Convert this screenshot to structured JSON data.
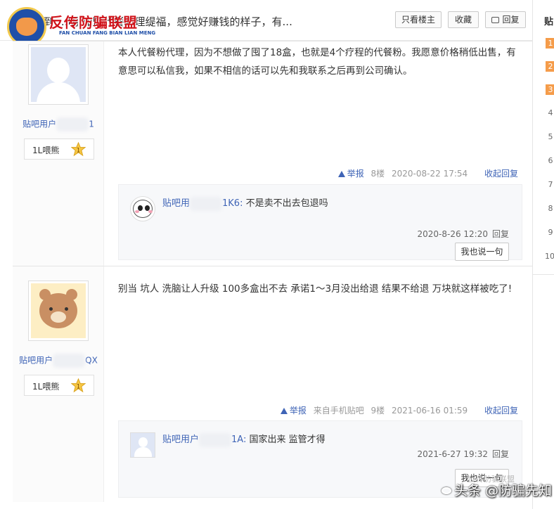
{
  "header": {
    "title": "到 …明 加盟代餐粉理缇福，感觉好赚钱的样子，有...",
    "only_author": "只看楼主",
    "favorite": "收藏",
    "reply": "回复"
  },
  "logo": {
    "text": "反传防骗联盟",
    "sub": "FAN CHUAN FANG BIAN LIAN MENG"
  },
  "sidebar": {
    "heading": "贴",
    "ranks": [
      "1",
      "2",
      "3",
      "4",
      "5",
      "6",
      "7",
      "8",
      "9",
      "10"
    ]
  },
  "posts": [
    {
      "author_prefix": "贴吧用户",
      "author_suffix": "1",
      "level": "1L喂熊",
      "level_badge": "1",
      "content": "本人代餐粉代理，因为不想做了囤了18盒，也就是4个疗程的代餐粉。我愿意价格稍低出售，有意思可以私信我，如果不相信的话可以先和我联系之后再到公司确认。",
      "report": "举报",
      "source": "",
      "floor": "8楼",
      "time": "2020-08-22 17:54",
      "collapse": "收起回复",
      "reply": {
        "user_prefix": "贴吧用",
        "user_suffix": "1K6:",
        "text": "不是卖不出去包退吗",
        "time": "2020-8-26 12:20",
        "reply_label": "回复",
        "say_button": "我也说一句"
      }
    },
    {
      "author_prefix": "贴吧用户",
      "author_suffix": "QX",
      "level": "1L喂熊",
      "level_badge": "1",
      "content": "别当 坑人 洗脑让人升级 100多盒出不去 承诺1～3月没出给退 结果不给退 万块就这样被吃了!",
      "report": "举报",
      "source": "来自手机贴吧",
      "floor": "9楼",
      "time": "2021-06-16 01:59",
      "collapse": "收起回复",
      "reply": {
        "user_prefix": "贴吧用户",
        "user_suffix": "1A:",
        "text": "国家出来 监管才得",
        "time": "2021-6-27 19:32",
        "reply_label": "回复",
        "say_button": "我也说一句"
      }
    }
  ],
  "watermark": {
    "text": "头条 @防骗先知",
    "small": "反传防骗联盟"
  }
}
